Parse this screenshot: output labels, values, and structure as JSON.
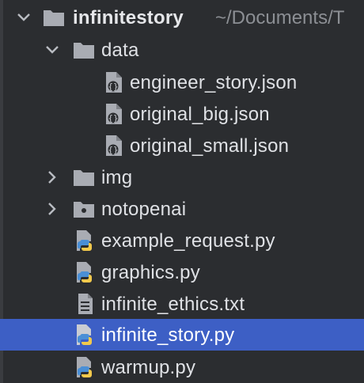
{
  "project": {
    "name": "infinitestory",
    "path": "~/Documents/T"
  },
  "folders": {
    "data": "data",
    "img": "img",
    "notopenai": "notopenai"
  },
  "data_files": [
    "engineer_story.json",
    "original_big.json",
    "original_small.json"
  ],
  "root_files": {
    "example_request": "example_request.py",
    "graphics": "graphics.py",
    "infinite_ethics": "infinite_ethics.txt",
    "infinite_story": "infinite_story.py",
    "warmup": "warmup.py"
  },
  "selected_item": "infinite_story.py",
  "colors": {
    "background": "#2b2d30",
    "selection": "#3d5fc5",
    "text": "#dfe1e5",
    "folder": "#a9acb3",
    "python_blue": "#4a8fd6",
    "python_yellow": "#f2c94c"
  }
}
